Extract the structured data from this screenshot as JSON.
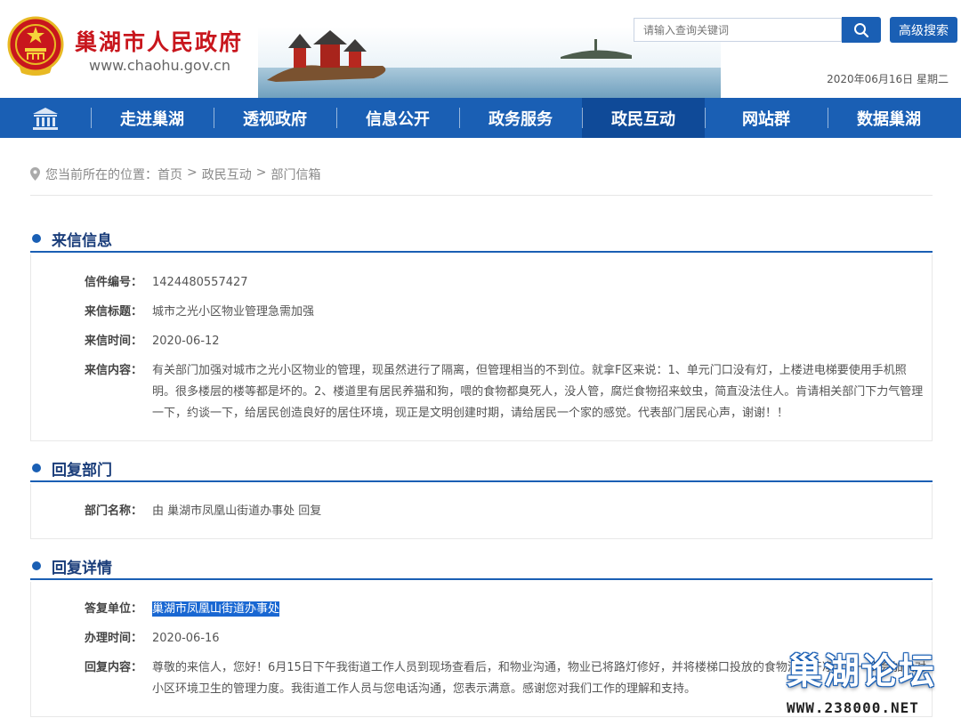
{
  "header": {
    "site_title": "巢湖市人民政府",
    "site_url": "www.chaohu.gov.cn",
    "search_placeholder": "请输入查询关键词",
    "advanced_search_label": "高级搜索",
    "date": "2020年06月16日 星期二"
  },
  "nav": {
    "home_icon": "home-building-icon",
    "items": [
      {
        "label": "走进巢湖"
      },
      {
        "label": "透视政府"
      },
      {
        "label": "信息公开"
      },
      {
        "label": "政务服务"
      },
      {
        "label": "政民互动",
        "active": true
      },
      {
        "label": "网站群"
      },
      {
        "label": "数据巢湖"
      }
    ]
  },
  "breadcrumb": {
    "prefix": "您当前所在的位置：",
    "items": [
      "首页",
      "政民互动",
      "部门信箱"
    ],
    "separator": ">"
  },
  "letter_info": {
    "title": "来信信息",
    "fields": [
      {
        "label": "信件编号：",
        "value": "1424480557427"
      },
      {
        "label": "来信标题：",
        "value": "城市之光小区物业管理急需加强"
      },
      {
        "label": "来信时间：",
        "value": "2020-06-12"
      },
      {
        "label": "来信内容：",
        "value": "有关部门加强对城市之光小区物业的管理，现虽然进行了隔离，但管理相当的不到位。就拿F区来说：1、单元门口没有灯，上楼进电梯要使用手机照明。很多楼层的楼等都是坏的。2、楼道里有居民养猫和狗，喂的食物都臭死人，没人管，腐烂食物招来蚊虫，简直没法住人。肯请相关部门下力气管理一下，约谈一下，给居民创造良好的居住环境，现正是文明创建时期，请给居民一个家的感觉。代表部门居民心声，谢谢！！"
      }
    ]
  },
  "reply_dept": {
    "title": "回复部门",
    "fields": [
      {
        "label": "部门名称：",
        "value": "由 巢湖市凤凰山街道办事处 回复"
      }
    ]
  },
  "reply_detail": {
    "title": "回复详情",
    "fields": [
      {
        "label": "答复单位：",
        "value": "巢湖市凤凰山街道办事处"
      },
      {
        "label": "办理时间：",
        "value": "2020-06-16"
      },
      {
        "label": "回复内容：",
        "value": "尊敬的来信人，您好！6月15日下午我街道工作人员到现场查看后，和物业沟通，物业已将路灯修好，并将楼梯口投放的食物清理干净。下一步会加大对小区环境卫生的管理力度。我街道工作人员与您电话沟通，您表示满意。感谢您对我们工作的理解和支持。"
      }
    ]
  },
  "watermark": {
    "name": "巢湖论坛",
    "url": "WWW.238000.NET"
  },
  "colors": {
    "brand_blue": "#1a5fb4",
    "title_red": "#c8161d"
  }
}
